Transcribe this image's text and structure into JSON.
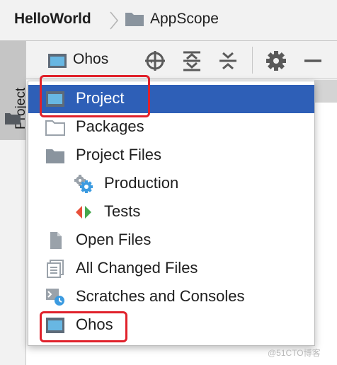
{
  "breadcrumb": {
    "root": "HelloWorld",
    "leaf": "AppScope"
  },
  "tool_window": {
    "tab_label": "Project"
  },
  "toolbar": {
    "view_selector": {
      "selected": "Ohos"
    },
    "buttons": [
      "locate-icon",
      "expand-all-icon",
      "collapse-all-icon",
      "gear-icon",
      "hide-icon"
    ]
  },
  "menu": {
    "items": [
      {
        "label": "Project",
        "icon": "project-view-icon",
        "selected": true
      },
      {
        "label": "Packages",
        "icon": "folder-outline-icon"
      },
      {
        "label": "Project Files",
        "icon": "folder-icon"
      },
      {
        "label": "Production",
        "icon": "gears-icon"
      },
      {
        "label": "Tests",
        "icon": "tests-icon"
      },
      {
        "label": "Open Files",
        "icon": "file-icon"
      },
      {
        "label": "All Changed Files",
        "icon": "changed-files-icon"
      },
      {
        "label": "Scratches and Consoles",
        "icon": "scratches-icon"
      },
      {
        "label": "Ohos",
        "icon": "ohos-view-icon"
      }
    ]
  },
  "watermark": "@51CTO博客",
  "colors": {
    "selection": "#2e5fb7",
    "annotation": "#e0212b",
    "view_icon_fill": "#68b7e3",
    "view_icon_frame": "#5e6b79",
    "folder": "#8a949e",
    "gear": "#3c9be0",
    "tests_red": "#e8503a",
    "tests_green": "#46a84e"
  }
}
